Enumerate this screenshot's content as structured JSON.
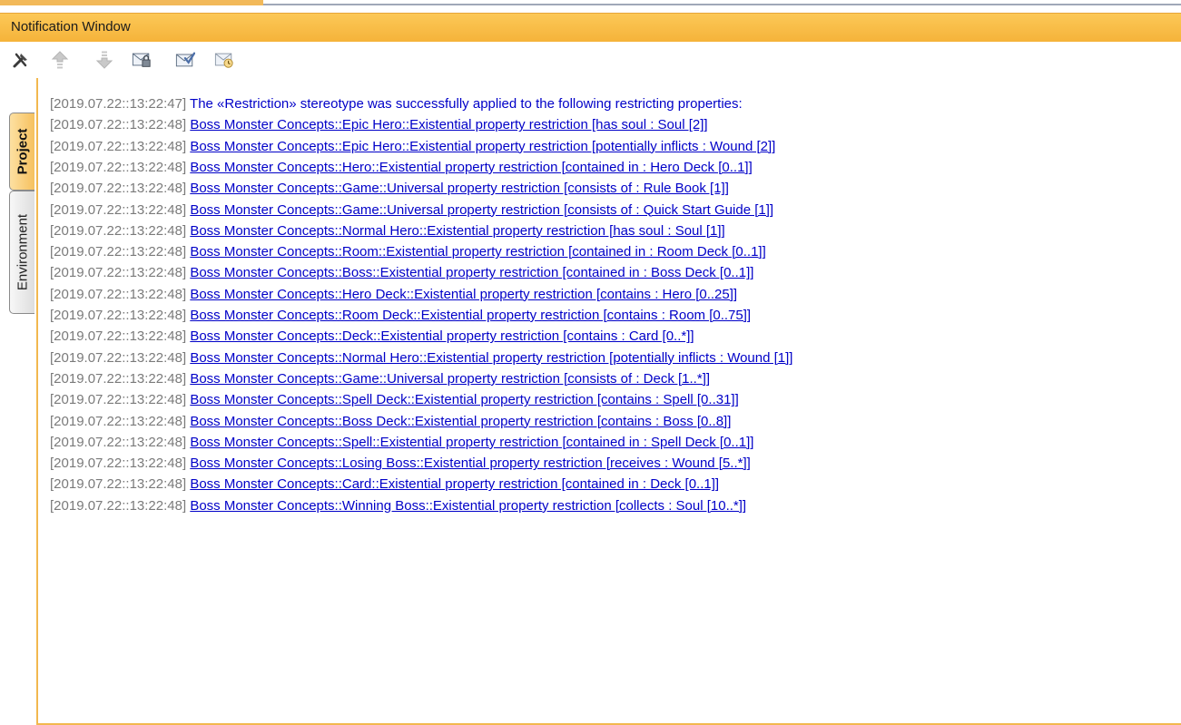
{
  "window": {
    "title": "Notification Window"
  },
  "toolbar": {
    "buttons": [
      {
        "name": "tools-icon",
        "tooltip": ""
      },
      {
        "name": "previous-up-arrow-icon",
        "tooltip": ""
      },
      {
        "name": "next-down-arrow-icon",
        "tooltip": ""
      },
      {
        "name": "mail-locked-icon",
        "tooltip": ""
      },
      {
        "name": "mail-check-icon",
        "tooltip": ""
      },
      {
        "name": "mail-clock-icon",
        "tooltip": ""
      }
    ]
  },
  "tabs": [
    {
      "label": "Project",
      "active": true
    },
    {
      "label": "Environment",
      "active": false
    }
  ],
  "colors": {
    "accent": "#f5b33a",
    "timestamp": "#7a7a7a",
    "link": "#0000c8"
  },
  "messages": [
    {
      "timestamp": "[2019.07.22::13:22:47]",
      "text": "The «Restriction» stereotype was successfully applied to the following restricting properties:",
      "link": false
    },
    {
      "timestamp": "[2019.07.22::13:22:48]",
      "text": "Boss Monster Concepts::Epic Hero::Existential property restriction [has soul : Soul [2]]",
      "link": true
    },
    {
      "timestamp": "[2019.07.22::13:22:48]",
      "text": "Boss Monster Concepts::Epic Hero::Existential property restriction [potentially inflicts : Wound [2]]",
      "link": true
    },
    {
      "timestamp": "[2019.07.22::13:22:48]",
      "text": "Boss Monster Concepts::Hero::Existential property restriction [contained in : Hero Deck [0..1]]",
      "link": true
    },
    {
      "timestamp": "[2019.07.22::13:22:48]",
      "text": "Boss Monster Concepts::Game::Universal property restriction [consists of : Rule Book [1]]",
      "link": true
    },
    {
      "timestamp": "[2019.07.22::13:22:48]",
      "text": "Boss Monster Concepts::Game::Universal property restriction [consists of : Quick Start Guide [1]]",
      "link": true
    },
    {
      "timestamp": "[2019.07.22::13:22:48]",
      "text": "Boss Monster Concepts::Normal Hero::Existential property restriction [has soul : Soul [1]]",
      "link": true
    },
    {
      "timestamp": "[2019.07.22::13:22:48]",
      "text": "Boss Monster Concepts::Room::Existential property restriction [contained in : Room Deck [0..1]]",
      "link": true
    },
    {
      "timestamp": "[2019.07.22::13:22:48]",
      "text": "Boss Monster Concepts::Boss::Existential property restriction [contained in : Boss Deck [0..1]]",
      "link": true
    },
    {
      "timestamp": "[2019.07.22::13:22:48]",
      "text": "Boss Monster Concepts::Hero Deck::Existential property restriction [contains : Hero [0..25]]",
      "link": true
    },
    {
      "timestamp": "[2019.07.22::13:22:48]",
      "text": "Boss Monster Concepts::Room Deck::Existential property restriction [contains : Room [0..75]]",
      "link": true
    },
    {
      "timestamp": "[2019.07.22::13:22:48]",
      "text": "Boss Monster Concepts::Deck::Existential property restriction [contains : Card [0..*]]",
      "link": true
    },
    {
      "timestamp": "[2019.07.22::13:22:48]",
      "text": "Boss Monster Concepts::Normal Hero::Existential property restriction [potentially inflicts : Wound [1]]",
      "link": true
    },
    {
      "timestamp": "[2019.07.22::13:22:48]",
      "text": "Boss Monster Concepts::Game::Universal property restriction [consists of : Deck [1..*]]",
      "link": true
    },
    {
      "timestamp": "[2019.07.22::13:22:48]",
      "text": "Boss Monster Concepts::Spell Deck::Existential property restriction [contains : Spell [0..31]]",
      "link": true
    },
    {
      "timestamp": "[2019.07.22::13:22:48]",
      "text": "Boss Monster Concepts::Boss Deck::Existential property restriction [contains : Boss [0..8]]",
      "link": true
    },
    {
      "timestamp": "[2019.07.22::13:22:48]",
      "text": "Boss Monster Concepts::Spell::Existential property restriction [contained in : Spell Deck [0..1]]",
      "link": true
    },
    {
      "timestamp": "[2019.07.22::13:22:48]",
      "text": "Boss Monster Concepts::Losing Boss::Existential property restriction [receives : Wound [5..*]]",
      "link": true
    },
    {
      "timestamp": "[2019.07.22::13:22:48]",
      "text": "Boss Monster Concepts::Card::Existential property restriction [contained in : Deck [0..1]]",
      "link": true
    },
    {
      "timestamp": "[2019.07.22::13:22:48]",
      "text": "Boss Monster Concepts::Winning Boss::Existential property restriction [collects : Soul [10..*]]",
      "link": true
    }
  ]
}
